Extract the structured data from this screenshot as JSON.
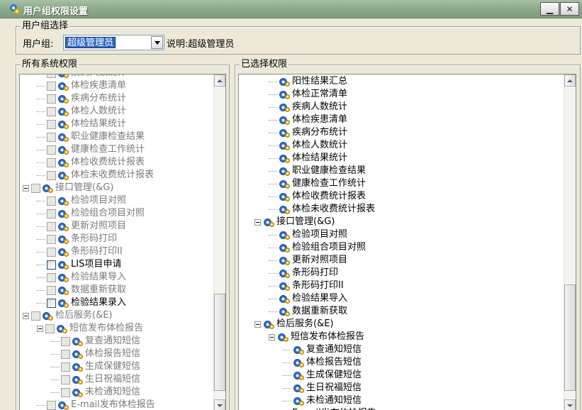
{
  "window": {
    "title": "用户组权限设置",
    "min_label": "▁",
    "close_label": "✕"
  },
  "user_group": {
    "legend": "用户组选择",
    "label": "用户组:",
    "selected": "超级管理员",
    "description": "说明:超级管理员"
  },
  "all_perms": {
    "legend": "所有系统权限",
    "nodes": [
      {
        "text": "疾病人数统计",
        "level": 2,
        "disabled": true
      },
      {
        "text": "体检疾患清单",
        "level": 2,
        "disabled": true
      },
      {
        "text": "疾病分布统计",
        "level": 2,
        "disabled": true
      },
      {
        "text": "体检人数统计",
        "level": 2,
        "disabled": true
      },
      {
        "text": "体检结果统计",
        "level": 2,
        "disabled": true
      },
      {
        "text": "职业健康检查结果",
        "level": 2,
        "disabled": true
      },
      {
        "text": "健康检查工作统计",
        "level": 2,
        "disabled": true
      },
      {
        "text": "体检收费统计报表",
        "level": 2,
        "disabled": true
      },
      {
        "text": "体检未收费统计报表",
        "level": 2,
        "disabled": true
      },
      {
        "text": "接口管理(&G)",
        "level": 1,
        "disabled": true,
        "expanded": true
      },
      {
        "text": "检验项目对照",
        "level": 2,
        "disabled": true
      },
      {
        "text": "检验组合项目对照",
        "level": 2,
        "disabled": true
      },
      {
        "text": "更新对照项目",
        "level": 2,
        "disabled": true
      },
      {
        "text": "条形码打印",
        "level": 2,
        "disabled": true
      },
      {
        "text": "条形码打印II",
        "level": 2,
        "disabled": true
      },
      {
        "text": "LIS项目申请",
        "level": 2,
        "disabled": false
      },
      {
        "text": "检验结果导入",
        "level": 2,
        "disabled": true
      },
      {
        "text": "数据重新获取",
        "level": 2,
        "disabled": true
      },
      {
        "text": "检验结果录入",
        "level": 2,
        "disabled": false
      },
      {
        "text": "检后服务(&E)",
        "level": 1,
        "disabled": true,
        "expanded": true
      },
      {
        "text": "短信发布体检报告",
        "level": 2,
        "disabled": true,
        "expanded": true
      },
      {
        "text": "复查通知短信",
        "level": 3,
        "disabled": true
      },
      {
        "text": "体检报告短信",
        "level": 3,
        "disabled": true
      },
      {
        "text": "生成保健短信",
        "level": 3,
        "disabled": true
      },
      {
        "text": "生日祝福短信",
        "level": 3,
        "disabled": true
      },
      {
        "text": "未检通知短信",
        "level": 3,
        "disabled": true
      },
      {
        "text": "E-mail发布体检报告",
        "level": 2,
        "disabled": true
      }
    ]
  },
  "selected_perms": {
    "legend": "已选择权限",
    "nodes": [
      {
        "text": "阳性结果汇总",
        "level": 2
      },
      {
        "text": "体检正常清单",
        "level": 2
      },
      {
        "text": "疾病人数统计",
        "level": 2
      },
      {
        "text": "体检疾患清单",
        "level": 2
      },
      {
        "text": "疾病分布统计",
        "level": 2
      },
      {
        "text": "体检人数统计",
        "level": 2
      },
      {
        "text": "体检结果统计",
        "level": 2
      },
      {
        "text": "职业健康检查结果",
        "level": 2
      },
      {
        "text": "健康检查工作统计",
        "level": 2
      },
      {
        "text": "体检收费统计报表",
        "level": 2
      },
      {
        "text": "体检未收费统计报表",
        "level": 2
      },
      {
        "text": "接口管理(&G)",
        "level": 1,
        "expanded": true
      },
      {
        "text": "检验项目对照",
        "level": 2
      },
      {
        "text": "检验组合项目对照",
        "level": 2
      },
      {
        "text": "更新对照项目",
        "level": 2
      },
      {
        "text": "条形码打印",
        "level": 2
      },
      {
        "text": "条形码打印II",
        "level": 2
      },
      {
        "text": "检验结果导入",
        "level": 2
      },
      {
        "text": "数据重新获取",
        "level": 2
      },
      {
        "text": "检后服务(&E)",
        "level": 1,
        "expanded": true
      },
      {
        "text": "短信发布体检报告",
        "level": 2,
        "expanded": true
      },
      {
        "text": "复查通知短信",
        "level": 3
      },
      {
        "text": "体检报告短信",
        "level": 3
      },
      {
        "text": "生成保健短信",
        "level": 3
      },
      {
        "text": "生日祝福短信",
        "level": 3
      },
      {
        "text": "未检通知短信",
        "level": 3
      },
      {
        "text": "E-mail发布体检报告",
        "level": 2
      }
    ]
  }
}
